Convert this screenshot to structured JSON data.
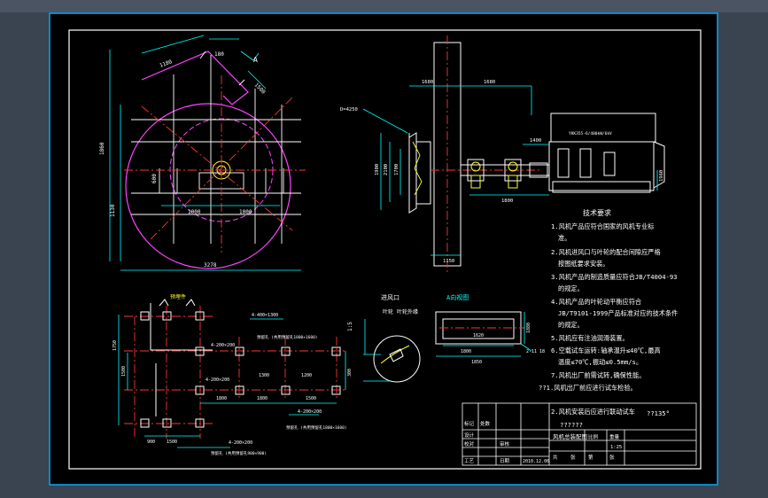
{
  "colors": {
    "background": "#3a4350",
    "sheet": "#000000",
    "frame": "#ffffff",
    "dim": "#00ffff",
    "center": "#ff3333",
    "magenta": "#ff44ff",
    "text": "#ffffff",
    "yellow": "#ffff33",
    "green": "#33ff33"
  },
  "top_view": {
    "labels": [
      "1180",
      "1500",
      "1860",
      "600",
      "1000",
      "1130",
      "1000",
      "3278",
      "180"
    ],
    "arrow_label": "A"
  },
  "side_view": {
    "labels": [
      "1680",
      "1680",
      "D=4250",
      "1900",
      "2100",
      "1700",
      "1400",
      "1960",
      "1800",
      "1150"
    ],
    "motor_label": "YKK355-6/400kW/6kV"
  },
  "plan_view": {
    "title": "预埋件",
    "labels": [
      "4-400×1300",
      "4-200×200",
      "4-200×200",
      "4-200×200",
      "4-200×200",
      "1750",
      "1500",
      "1800",
      "1500",
      "1800",
      "1500",
      "300",
      "900",
      "1300",
      "1200"
    ],
    "anchor_labels": [
      "预留孔 (共用预留孔1800×1600)",
      "预留孔 (共用预留孔1800×1600)",
      "预留孔 (共用预留孔900×900)"
    ]
  },
  "section": {
    "title": "A向视图",
    "labels": [
      "1620",
      "1800",
      "1850",
      "1880",
      "2-11 18"
    ]
  },
  "detail": {
    "labels": [
      "进风口",
      "1:5",
      "叶轮",
      "叶轮外缘"
    ]
  },
  "tech": {
    "heading": "技术要求",
    "lines": [
      "1.风机产品应符合国家的风机专业标",
      "准。",
      "2.风机进风口与叶轮的配合间隙应严格",
      "按图纸要求安装。",
      "3.风机产品的制造质量应符合JB/T4004-93",
      "的规定。",
      "4.风机产品的叶轮动平衡应符合",
      "JB/T9101-1999产品标准对应的技术条件",
      "的规定。",
      "5.风机应有注油润滑装置。",
      "6.空载试车运转:轴承温升≤40℃,最高",
      "温度≤70℃,振动≤0.5mm/s。",
      "7.风机出厂前需试转,确保性能。"
    ],
    "overlay_lines": [
      "??1.风机出厂前应进行试车检验。",
      "2.风机安装后应进行联动试车",
      "??????"
    ],
    "angle": "??135°"
  },
  "title_block": {
    "cells": [
      "设计",
      "校对",
      "审核",
      "标记",
      "处数",
      "工艺",
      "日期",
      "风机总装配图",
      "比例",
      "重量",
      "1:25",
      "共",
      "张",
      "第",
      "张",
      "2010.12.06"
    ]
  }
}
